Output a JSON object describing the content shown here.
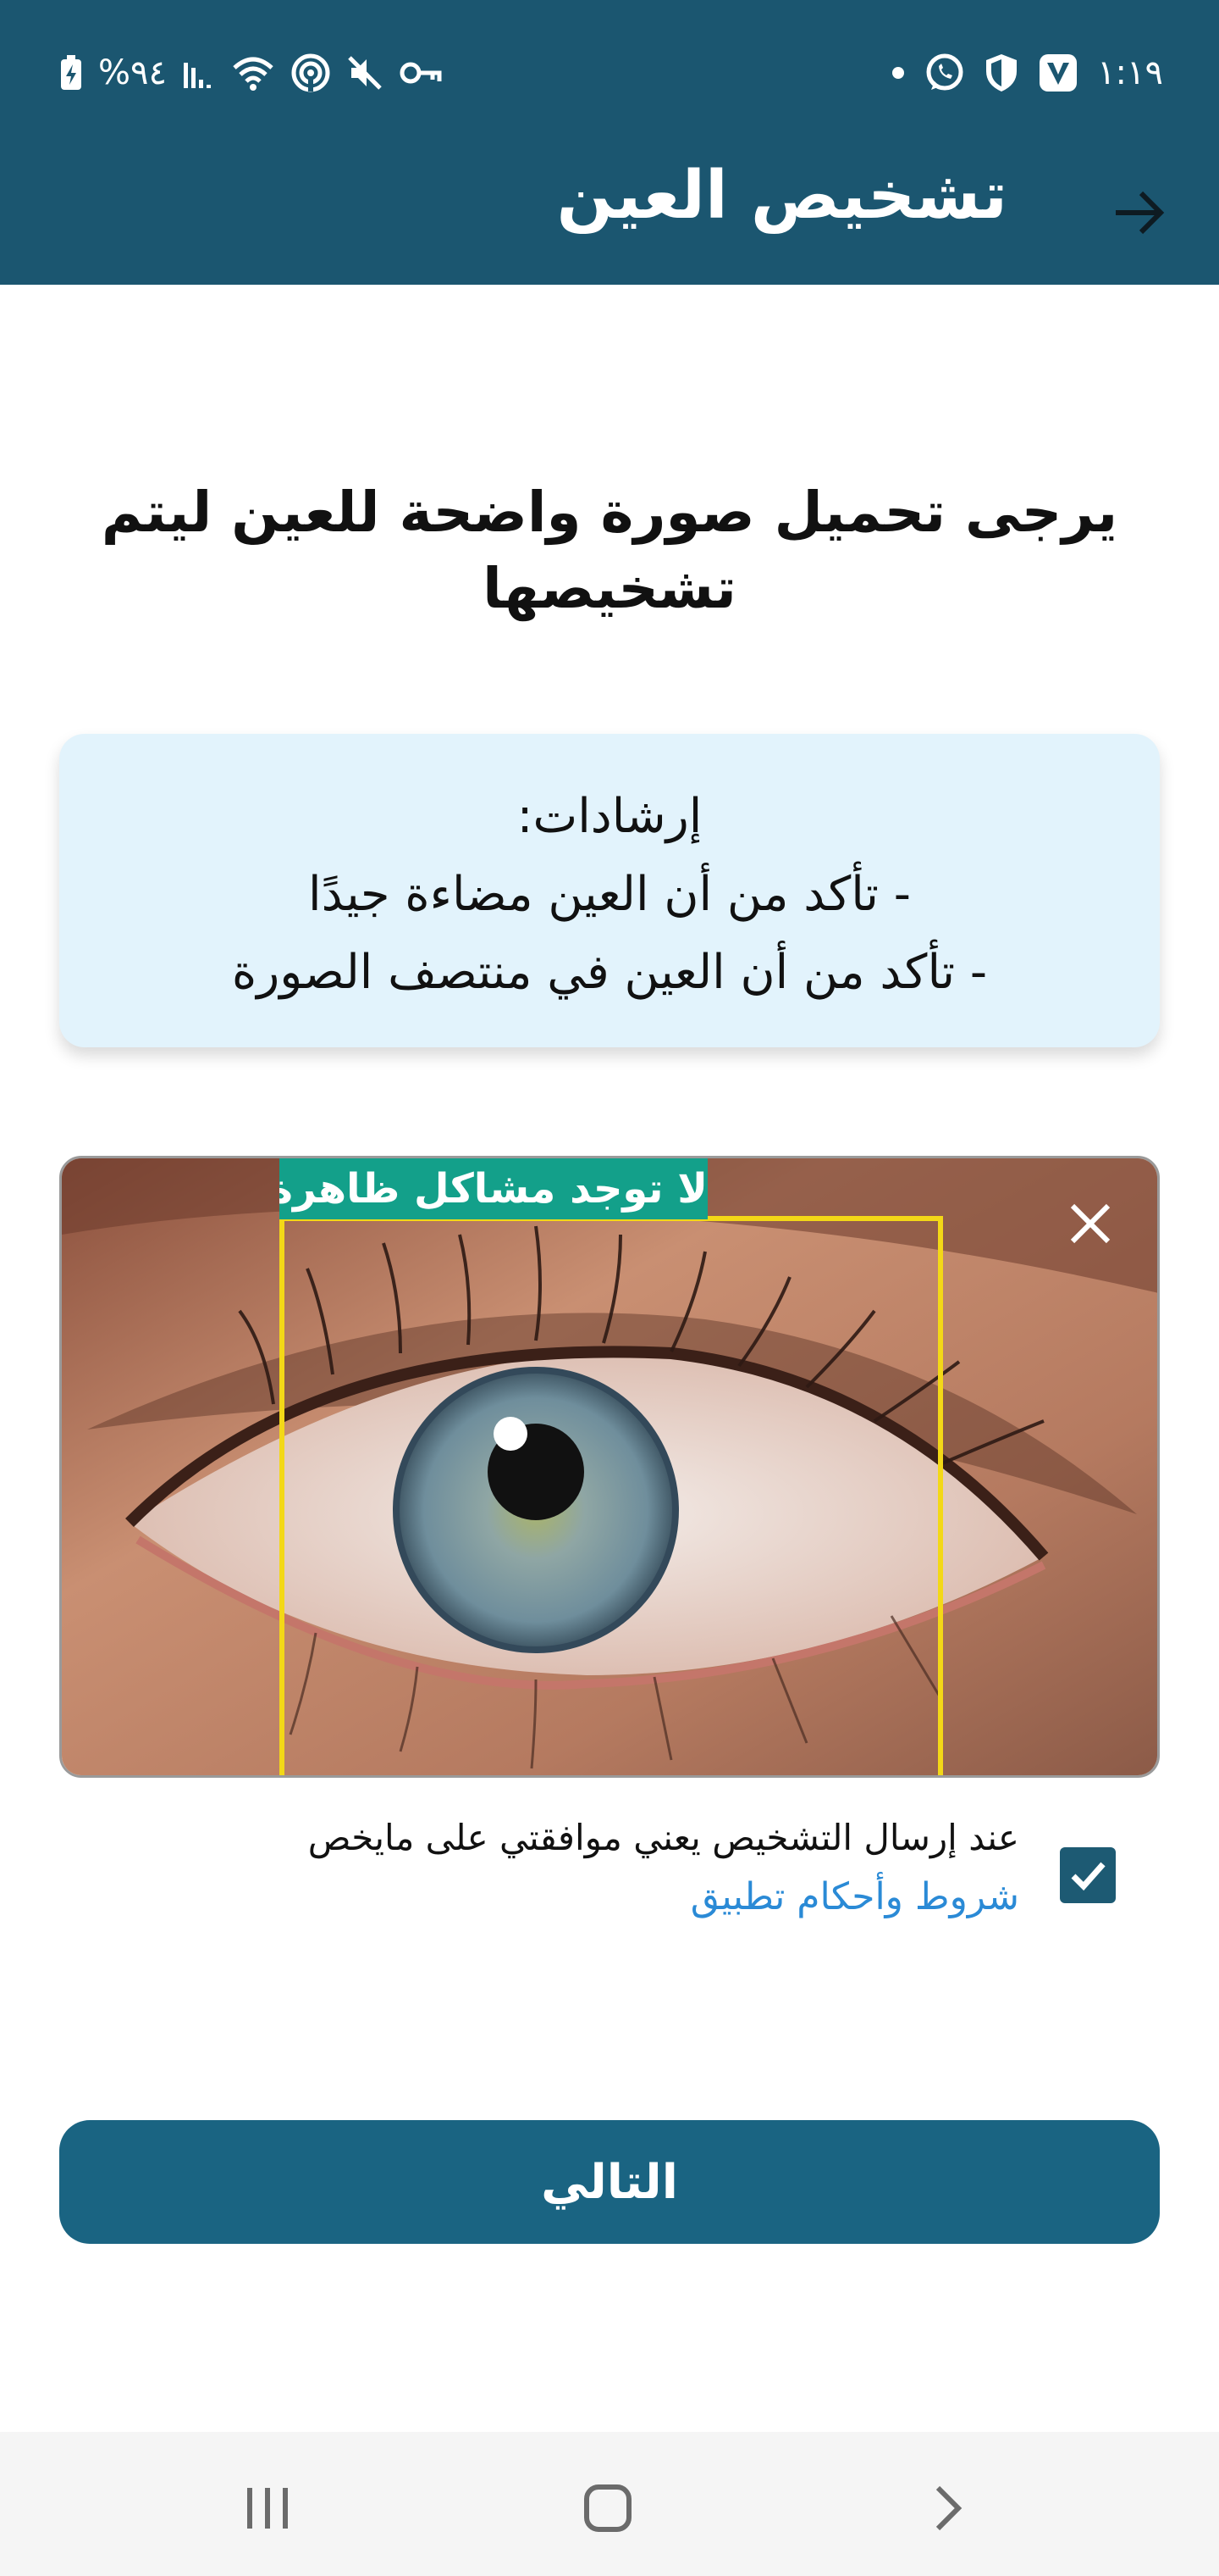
{
  "status_bar": {
    "battery_percent": "%٩٤",
    "time": "١:١٩",
    "icons_left": [
      "battery-charging-icon",
      "signal-icon",
      "wifi-icon",
      "hotspot-icon",
      "mute-icon",
      "vpn-key-icon"
    ],
    "icons_right": [
      "dot-icon",
      "whatsapp-icon",
      "shield-icon",
      "v-app-icon"
    ]
  },
  "app_bar": {
    "title": "تشخيص العين",
    "back_icon": "arrow-right-icon"
  },
  "main": {
    "heading": "يرجى تحميل صورة واضحة للعين ليتم تشخيصها",
    "guidelines": {
      "title": "إرشادات:",
      "items": [
        "- تأكد من أن العين مضاءة جيدًا",
        "- تأكد من أن العين في منتصف الصورة"
      ]
    },
    "image": {
      "detection_label": "لا توجد مشاكل ظاهرة",
      "remove_icon": "close-icon"
    },
    "consent": {
      "text": "عند إرسال التشخيص يعني موافقتي على مايخص",
      "link": "شروط وأحكام تطبيق",
      "checked": true
    },
    "next_button": "التالي"
  },
  "nav_bar": {
    "items": [
      "recent-apps-icon",
      "home-icon",
      "back-icon"
    ]
  },
  "colors": {
    "primary": "#1b5670",
    "button": "#1a6482",
    "guide_bg": "#e2f3fc",
    "detection_label": "#13a08a",
    "detection_box": "#f3d817",
    "link": "#2a8ad6"
  }
}
